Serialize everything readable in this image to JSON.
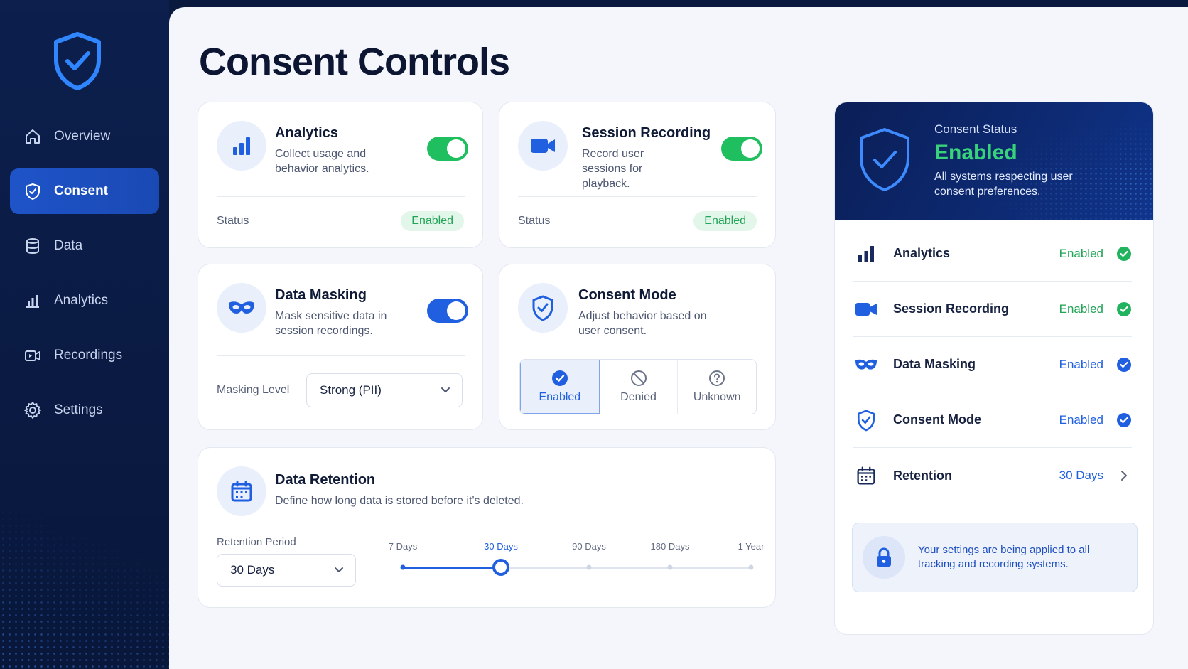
{
  "sidebar": {
    "items": [
      {
        "label": "Overview",
        "icon": "home-icon"
      },
      {
        "label": "Consent",
        "icon": "shield-check-icon",
        "active": true
      },
      {
        "label": "Data",
        "icon": "database-icon"
      },
      {
        "label": "Analytics",
        "icon": "bar-chart-icon"
      },
      {
        "label": "Recordings",
        "icon": "video-icon"
      },
      {
        "label": "Settings",
        "icon": "gear-icon"
      }
    ]
  },
  "page": {
    "title": "Consent Controls"
  },
  "analytics_card": {
    "title": "Analytics",
    "description": "Collect usage and behavior analytics.",
    "toggle_on": true,
    "status_label": "Status",
    "status_value": "Enabled"
  },
  "session_card": {
    "title": "Session Recording",
    "description": "Record user sessions for playback.",
    "toggle_on": true,
    "status_label": "Status",
    "status_value": "Enabled"
  },
  "masking_card": {
    "title": "Data Masking",
    "description": "Mask sensitive data in session recordings.",
    "toggle_on": true,
    "level_label": "Masking Level",
    "level_value": "Strong (PII)"
  },
  "consent_mode_card": {
    "title": "Consent Mode",
    "description": "Adjust behavior based on user consent.",
    "options": [
      "Enabled",
      "Denied",
      "Unknown"
    ],
    "selected": "Enabled"
  },
  "retention_card": {
    "title": "Data Retention",
    "description": "Define how long data is stored before it's deleted.",
    "period_label": "Retention Period",
    "period_value": "30 Days",
    "slider_stops": [
      "7 Days",
      "30 Days",
      "90 Days",
      "180 Days",
      "1 Year"
    ],
    "slider_selected_index": 1
  },
  "status_panel": {
    "heading": "Consent Status",
    "state": "Enabled",
    "description": "All systems respecting user consent preferences.",
    "rows": [
      {
        "name": "Analytics",
        "value": "Enabled",
        "icon": "bar-chart-icon"
      },
      {
        "name": "Session Recording",
        "value": "Enabled",
        "icon": "video-icon"
      },
      {
        "name": "Data Masking",
        "value": "Enabled",
        "icon": "mask-icon"
      },
      {
        "name": "Consent Mode",
        "value": "Enabled",
        "icon": "shield-check-icon"
      },
      {
        "name": "Retention",
        "value": "30 Days",
        "icon": "calendar-icon"
      }
    ],
    "note": "Your settings are being applied to all tracking and recording systems."
  },
  "colors": {
    "brand_blue": "#1f5fe0",
    "toggle_green": "#1fbf5f",
    "enabled_green": "#22a356",
    "navy": "#0b1f57"
  }
}
